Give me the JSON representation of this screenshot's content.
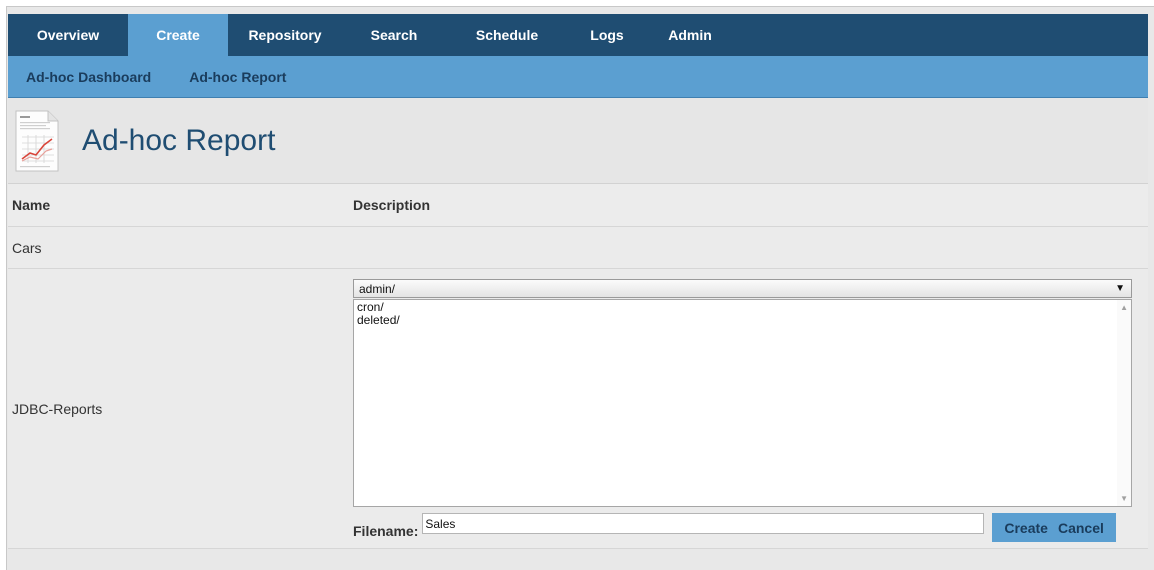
{
  "nav": {
    "tabs": [
      {
        "label": "Overview"
      },
      {
        "label": "Create"
      },
      {
        "label": "Repository"
      },
      {
        "label": "Search"
      },
      {
        "label": "Schedule"
      },
      {
        "label": "Logs"
      },
      {
        "label": "Admin"
      }
    ],
    "active": "Create"
  },
  "subnav": {
    "items": [
      {
        "label": "Ad-hoc Dashboard"
      },
      {
        "label": "Ad-hoc Report"
      }
    ]
  },
  "header": {
    "title": "Ad-hoc Report",
    "icon": "report-chart-icon"
  },
  "table": {
    "columns": [
      "Name",
      "Description"
    ],
    "rows": [
      {
        "name": "Cars",
        "description": ""
      },
      {
        "name": "JDBC-Reports"
      }
    ]
  },
  "folder_select": {
    "selected": "admin/"
  },
  "folder_list": {
    "items": [
      "cron/",
      "deleted/"
    ]
  },
  "filename": {
    "label": "Filename:",
    "value": "Sales"
  },
  "buttons": {
    "create": "Create",
    "cancel": "Cancel"
  },
  "colors": {
    "nav_bg": "#1f4d72",
    "accent": "#5b9fd1",
    "page_bg": "#e8e8e8",
    "title": "#1f4d72"
  }
}
